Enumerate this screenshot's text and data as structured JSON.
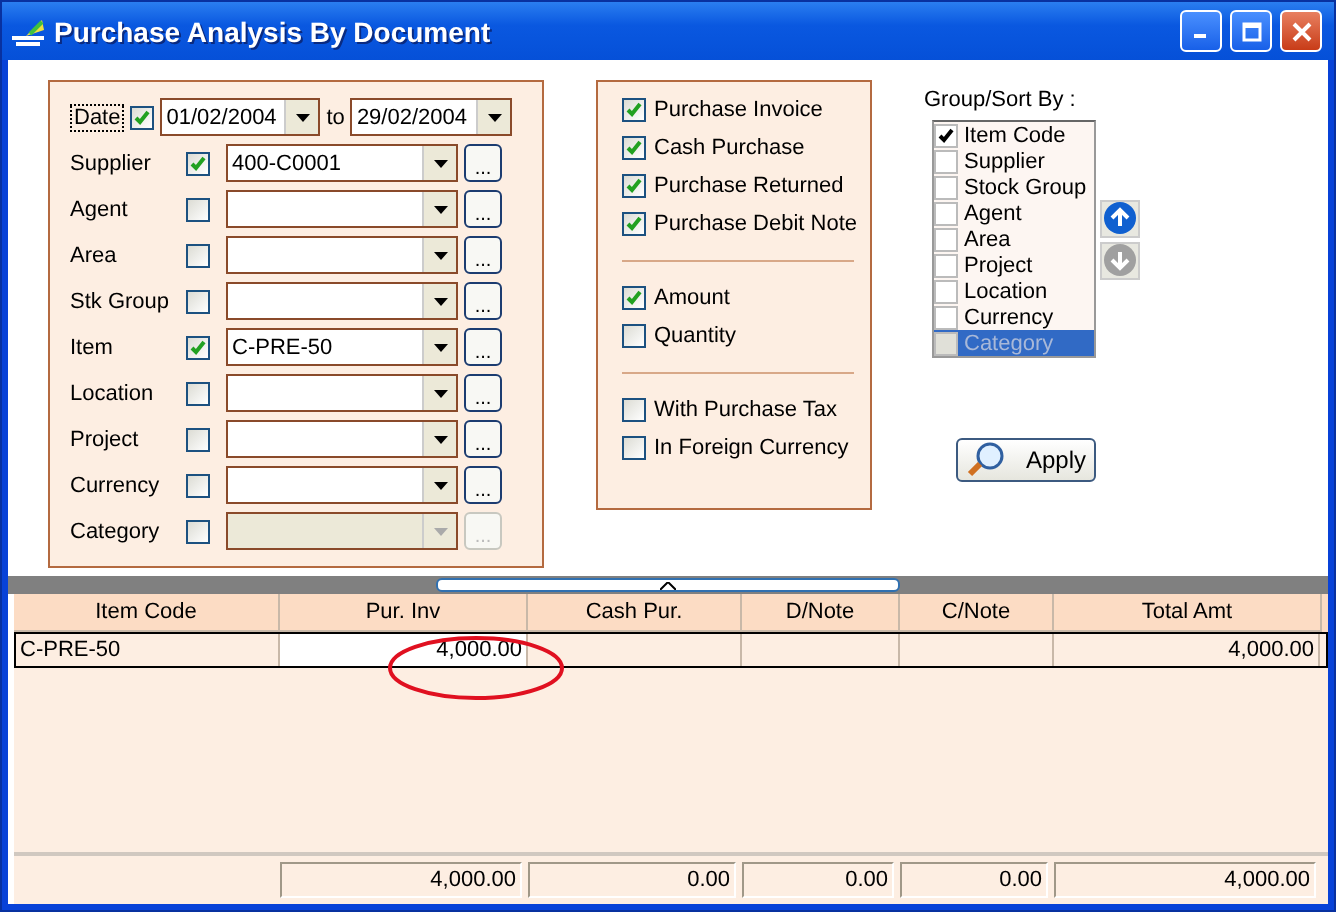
{
  "window": {
    "title": "Purchase Analysis By Document"
  },
  "date_filter": {
    "label": "Date",
    "checked": true,
    "from": "01/02/2004",
    "separator": "to",
    "to": "29/02/2004"
  },
  "filters": [
    {
      "label": "Supplier",
      "checked": true,
      "value": "400-C0001",
      "disabled": false,
      "browse": "..."
    },
    {
      "label": "Agent",
      "checked": false,
      "disabled": false,
      "browse": "..."
    },
    {
      "label": "Area",
      "checked": false,
      "disabled": false,
      "browse": "..."
    },
    {
      "label": "Stk Group",
      "checked": false,
      "disabled": false,
      "browse": "..."
    },
    {
      "label": "Item",
      "checked": true,
      "value": "C-PRE-50",
      "disabled": false,
      "browse": "..."
    },
    {
      "label": "Location",
      "checked": false,
      "disabled": false,
      "browse": "..."
    },
    {
      "label": "Project",
      "checked": false,
      "disabled": false,
      "browse": "..."
    },
    {
      "label": "Currency",
      "checked": false,
      "disabled": false,
      "browse": "..."
    },
    {
      "label": "Category",
      "checked": false,
      "disabled": true,
      "browse": "..."
    }
  ],
  "options": [
    [
      {
        "label": "Purchase Invoice",
        "checked": true
      },
      {
        "label": "Cash Purchase",
        "checked": true
      },
      {
        "label": "Purchase Returned",
        "checked": true
      },
      {
        "label": "Purchase Debit Note",
        "checked": true
      }
    ],
    [
      {
        "label": "Amount",
        "checked": true
      },
      {
        "label": "Quantity",
        "checked": false
      }
    ],
    [
      {
        "label": "With Purchase Tax",
        "checked": false
      },
      {
        "label": "In Foreign Currency",
        "checked": false
      }
    ]
  ],
  "group_sort": {
    "label": "Group/Sort By :",
    "items": [
      {
        "label": "Item Code",
        "checked": true,
        "selected": false,
        "disabled": false
      },
      {
        "label": "Supplier",
        "checked": false,
        "selected": false,
        "disabled": false
      },
      {
        "label": "Stock Group",
        "checked": false,
        "selected": false,
        "disabled": false
      },
      {
        "label": "Agent",
        "checked": false,
        "selected": false,
        "disabled": false
      },
      {
        "label": "Area",
        "checked": false,
        "selected": false,
        "disabled": false
      },
      {
        "label": "Project",
        "checked": false,
        "selected": false,
        "disabled": false
      },
      {
        "label": "Location",
        "checked": false,
        "selected": false,
        "disabled": false
      },
      {
        "label": "Currency",
        "checked": false,
        "selected": false,
        "disabled": false
      },
      {
        "label": "Category",
        "checked": false,
        "selected": true,
        "disabled": true
      }
    ],
    "move_buttons": [
      {
        "kind": "up",
        "disabled": false
      },
      {
        "kind": "down",
        "disabled": true
      }
    ]
  },
  "apply_button": {
    "label": "Apply"
  },
  "table": {
    "columns": [
      "Item Code",
      "Pur. Inv",
      "Cash Pur.",
      "D/Note",
      "C/Note",
      "Total Amt"
    ],
    "rows": [
      {
        "cells": [
          {
            "text": "C-PRE-50",
            "focused": false
          },
          {
            "text": "4,000.00",
            "focused": true
          },
          {
            "text": "",
            "focused": false
          },
          {
            "text": "",
            "focused": false
          },
          {
            "text": "",
            "focused": false
          },
          {
            "text": "4,000.00",
            "focused": false
          }
        ]
      }
    ],
    "totals": [
      "4,000.00",
      "0.00",
      "0.00",
      "0.00",
      "4,000.00"
    ]
  }
}
